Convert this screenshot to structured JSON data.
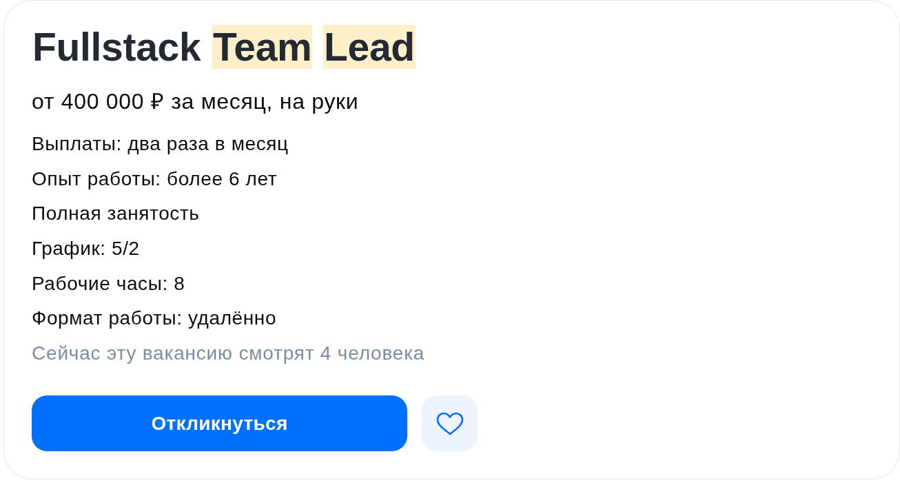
{
  "vacancy": {
    "title": [
      {
        "text": "Fullstack",
        "highlighted": false
      },
      {
        "text": "Team",
        "highlighted": true
      },
      {
        "text": "Lead",
        "highlighted": true
      }
    ],
    "salary": "от 400 000 ₽ за месяц, на руки",
    "details": [
      "Выплаты: два раза в месяц",
      "Опыт работы: более 6 лет",
      "Полная занятость",
      "График: 5/2",
      "Рабочие часы: 8",
      "Формат работы: удалённо"
    ],
    "viewers_note": "Сейчас эту вакансию смотрят 4 человека",
    "apply_button": "Откликнуться",
    "favorite": {
      "favorited": false
    }
  }
}
